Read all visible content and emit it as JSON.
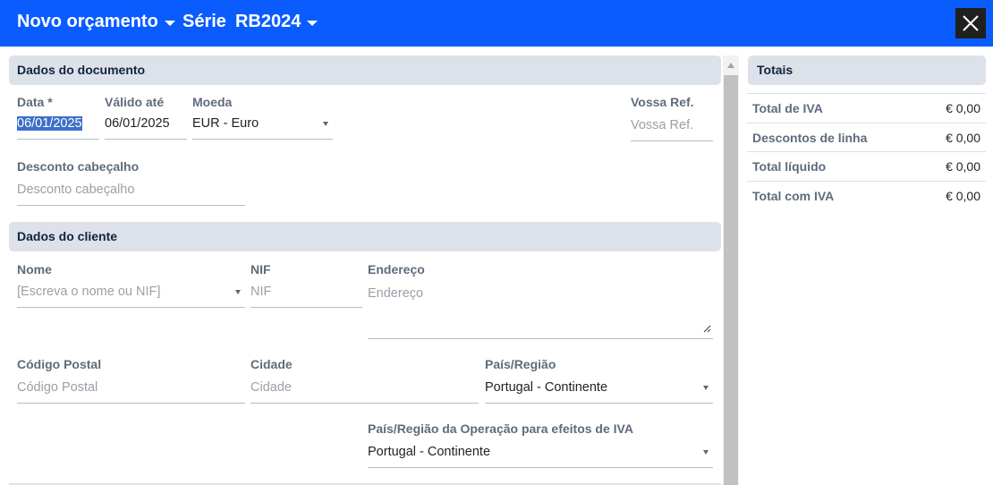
{
  "header": {
    "doc_type": "Novo orçamento",
    "series_label": "Série",
    "series_value": "RB2024"
  },
  "document": {
    "section_title": "Dados do documento",
    "date_label": "Data *",
    "date_value": "06/01/2025",
    "valid_until_label": "Válido até",
    "valid_until_value": "06/01/2025",
    "currency_label": "Moeda",
    "currency_value": "EUR - Euro",
    "your_ref_label": "Vossa Ref.",
    "your_ref_placeholder": "Vossa Ref.",
    "header_discount_label": "Desconto cabeçalho",
    "header_discount_placeholder": "Desconto cabeçalho"
  },
  "client": {
    "section_title": "Dados do cliente",
    "name_label": "Nome",
    "name_placeholder": "[Escreva o nome ou NIF]",
    "nif_label": "NIF",
    "nif_placeholder": "NIF",
    "address_label": "Endereço",
    "address_placeholder": "Endereço",
    "postal_label": "Código Postal",
    "postal_placeholder": "Código Postal",
    "city_label": "Cidade",
    "city_placeholder": "Cidade",
    "country_label": "País/Região",
    "country_value": "Portugal - Continente",
    "vat_country_label": "País/Região da Operação para efeitos de IVA",
    "vat_country_value": "Portugal - Continente"
  },
  "totals": {
    "title": "Totais",
    "rows": [
      {
        "label": "Total de IVA",
        "value": "€ 0,00"
      },
      {
        "label": "Descontos de linha",
        "value": "€ 0,00"
      },
      {
        "label": "Total líquido",
        "value": "€ 0,00"
      },
      {
        "label": "Total com IVA",
        "value": "€ 0,00"
      }
    ]
  },
  "colors": {
    "header_bg": "#0a5cff",
    "section_bg": "#dde2ea",
    "label_text": "#5f6b7d",
    "selection_highlight": "#3d6fc9"
  },
  "icons": [
    "chevron-down-icon",
    "close-icon",
    "resize-handle-icon",
    "scroll-up-icon"
  ]
}
